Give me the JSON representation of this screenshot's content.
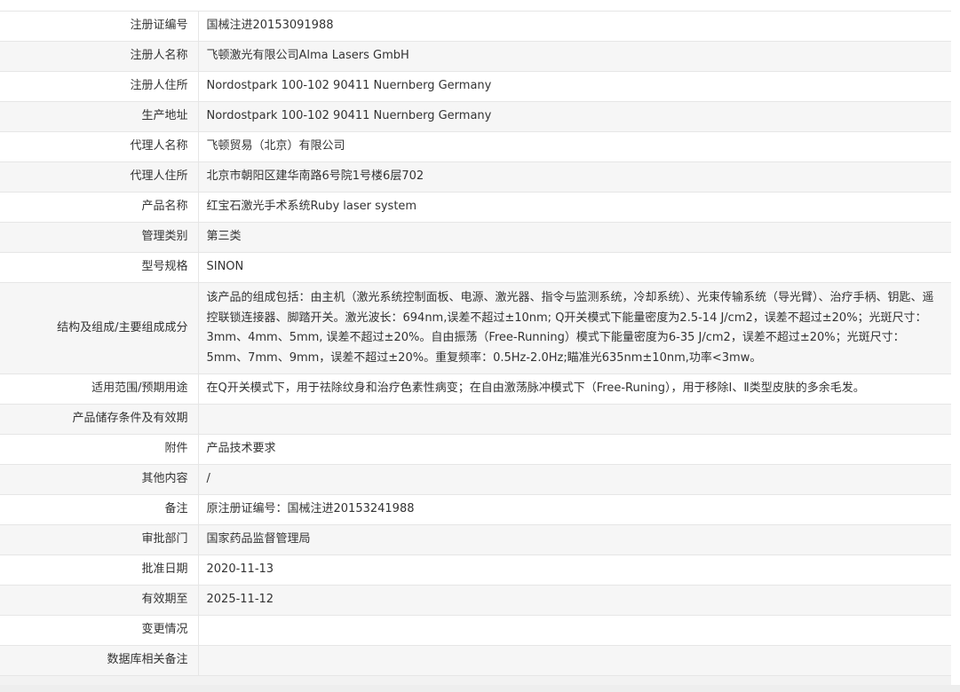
{
  "record": {
    "rows": [
      {
        "label": "注册证编号",
        "value": "国械注进20153091988"
      },
      {
        "label": "注册人名称",
        "value": "飞顿激光有限公司Alma Lasers GmbH"
      },
      {
        "label": "注册人住所",
        "value": "Nordostpark 100-102 90411 Nuernberg Germany"
      },
      {
        "label": "生产地址",
        "value": "Nordostpark 100-102 90411 Nuernberg Germany"
      },
      {
        "label": "代理人名称",
        "value": "飞顿贸易（北京）有限公司"
      },
      {
        "label": "代理人住所",
        "value": "北京市朝阳区建华南路6号院1号楼6层702"
      },
      {
        "label": "产品名称",
        "value": "红宝石激光手术系统Ruby laser system"
      },
      {
        "label": "管理类别",
        "value": "第三类"
      },
      {
        "label": "型号规格",
        "value": "SINON"
      },
      {
        "label": "结构及组成/主要组成成分",
        "value": "该产品的组成包括：由主机（激光系统控制面板、电源、激光器、指令与监测系统，冷却系统）、光束传输系统（导光臂）、治疗手柄、钥匙、遥控联锁连接器、脚踏开关。激光波长：694nm,误差不超过±10nm; Q开关模式下能量密度为2.5-14 J/cm2，误差不超过±20%；光斑尺寸：3mm、4mm、5mm, 误差不超过±20%。自由振荡（Free-Running）模式下能量密度为6-35 J/cm2，误差不超过±20%；光斑尺寸：5mm、7mm、9mm，误差不超过±20%。重复频率：0.5Hz-2.0Hz;瞄准光635nm±10nm,功率<3mw。"
      },
      {
        "label": "适用范围/预期用途",
        "value": "在Q开关模式下，用于祛除纹身和治疗色素性病变；在自由激荡脉冲模式下（Free-Runing），用于移除Ⅰ、Ⅱ类型皮肤的多余毛发。"
      },
      {
        "label": "产品储存条件及有效期",
        "value": ""
      },
      {
        "label": "附件",
        "value": "产品技术要求"
      },
      {
        "label": "其他内容",
        "value": "/"
      },
      {
        "label": "备注",
        "value": "原注册证编号：国械注进20153241988"
      },
      {
        "label": "审批部门",
        "value": "国家药品监督管理局"
      },
      {
        "label": "批准日期",
        "value": "2020-11-13"
      },
      {
        "label": "有效期至",
        "value": "2025-11-12"
      },
      {
        "label": "变更情况",
        "value": ""
      },
      {
        "label": "数据库相关备注",
        "value": ""
      }
    ]
  }
}
